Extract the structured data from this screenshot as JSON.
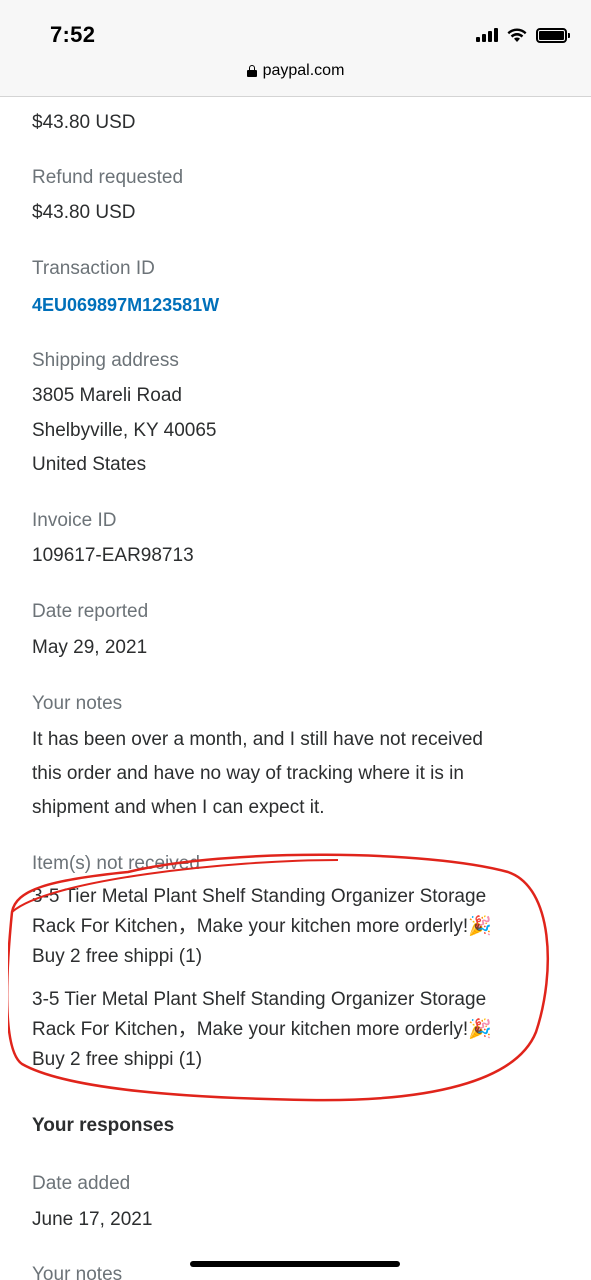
{
  "status_bar": {
    "time": "7:52"
  },
  "browser": {
    "url": "paypal.com"
  },
  "details": {
    "amount_value": "$43.80 USD",
    "refund_label": "Refund requested",
    "refund_value": "$43.80 USD",
    "transaction_label": "Transaction ID",
    "transaction_value": "4EU069897M123581W",
    "shipping_label": "Shipping address",
    "shipping_line1": "3805 Mareli Road",
    "shipping_line2": "Shelbyville, KY 40065",
    "shipping_line3": "United States",
    "invoice_label": "Invoice ID",
    "invoice_value": "109617-EAR98713",
    "date_reported_label": "Date reported",
    "date_reported_value": "May 29, 2021",
    "notes_label": "Your notes",
    "notes_line1": "It has been over a month, and I still have not received",
    "notes_line2": "this order and have no way of tracking where it is in",
    "notes_line3": "shipment and when I can expect it.",
    "items_label": "Item(s) not received",
    "items": [
      {
        "line1": "3-5 Tier Metal Plant Shelf Standing Organizer Storage",
        "line2": "Rack For Kitchen，Make your kitchen more orderly!🎉",
        "line3": "Buy 2 free shippi (1)"
      },
      {
        "line1": "3-5 Tier Metal Plant Shelf Standing Organizer Storage",
        "line2": "Rack For Kitchen，Make your kitchen more orderly!🎉",
        "line3": "Buy 2 free shippi (1)"
      }
    ]
  },
  "responses": {
    "heading": "Your responses",
    "date_added_label": "Date added",
    "date_added_value": "June 17, 2021",
    "notes_label": "Your notes"
  },
  "colors": {
    "link": "#0070ba",
    "label": "#6c7378",
    "annotation": "#e0241b"
  }
}
